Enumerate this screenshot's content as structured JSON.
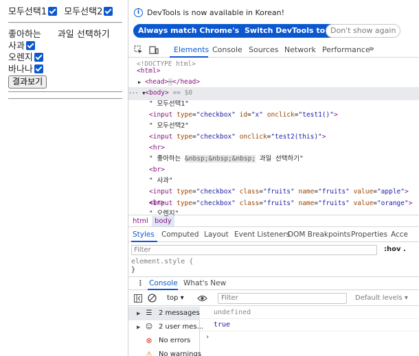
{
  "page": {
    "select_all_1": "모두선택1",
    "select_all_2": "모두선택2",
    "label_like": "좋아하는",
    "label_select": "과일 선택하기",
    "fruits": [
      "사과",
      "오렌지",
      "바나나"
    ],
    "result_button": "결과보기"
  },
  "devtools": {
    "info_text": "DevTools is now available in Korean!",
    "buttons": {
      "match_language": "Always match Chrome's language",
      "switch_korean": "Switch DevTools to Korean",
      "dont_show": "Don't show again"
    },
    "tabs": [
      "Elements",
      "Console",
      "Sources",
      "Network",
      "Performance"
    ],
    "more_tabs": "»",
    "dom": {
      "doctype": "<!DOCTYPE html>",
      "html_open": "<html>",
      "head": "<head>",
      "head_dots": "⋯",
      "head_close": "</head>",
      "body_tag": "<body>",
      "body_eq": "== $0",
      "t1": "\" 모두선택1\"",
      "in1_tag": "<input",
      "in1_type_attr": "type",
      "in1_type_val": "\"checkbox\"",
      "in1_id_attr": "id",
      "in1_id_val": "\"x\"",
      "in1_onclick_attr": "onclick",
      "in1_onclick_val": "\"test1()\"",
      "close_angle": ">",
      "t2": "\" 모두선택2\"",
      "in2_onclick_val": "\"test2(this)\"",
      "hr": "<hr>",
      "t3_start": "\" 좋아하는 ",
      "t3_entity": "&nbsp;&nbsp;&nbsp;",
      "t3_end": " 과일 선택하기\"",
      "br": "<br>",
      "t4": "\" 사과\"",
      "in_class_attr": "class",
      "in_class_val": "\"fruits\"",
      "in_name_attr": "name",
      "in_name_val": "\"fruits\"",
      "in_value_attr": "value",
      "apple_val": "\"apple\"",
      "t5": "\" 오렌지\"",
      "orange_val": "\"orange\"",
      "eq": "=",
      "partial_br": "<br>"
    },
    "breadcrumbs": [
      "html",
      "body"
    ],
    "subtabs": [
      "Styles",
      "Computed",
      "Layout",
      "Event Listeners",
      "DOM Breakpoints",
      "Properties",
      "Acce"
    ],
    "filter_placeholder": "Filter",
    "hov": ":hov .",
    "element_style": "element.style {",
    "element_style_close": "}",
    "drawer_tabs": [
      "Console",
      "What's New"
    ],
    "drawer_menu": "⋮",
    "console_context": "top ▾",
    "console_filter": "Filter",
    "default_levels": "Default levels ▾",
    "sidebar": [
      {
        "label": "2 messages",
        "icon": "list-icon"
      },
      {
        "label": "2 user mes...",
        "icon": "user-icon"
      },
      {
        "label": "No errors",
        "icon": "error-icon"
      },
      {
        "label": "No warnings",
        "icon": "warning-icon"
      }
    ],
    "console_output": [
      "undefined",
      "true"
    ],
    "prompt": "›"
  },
  "colors": {
    "accent": "#0b57d0",
    "tag": "#881280",
    "attr": "#994500",
    "value": "#1a1aa6",
    "error": "#d93025",
    "warning": "#e37400"
  }
}
